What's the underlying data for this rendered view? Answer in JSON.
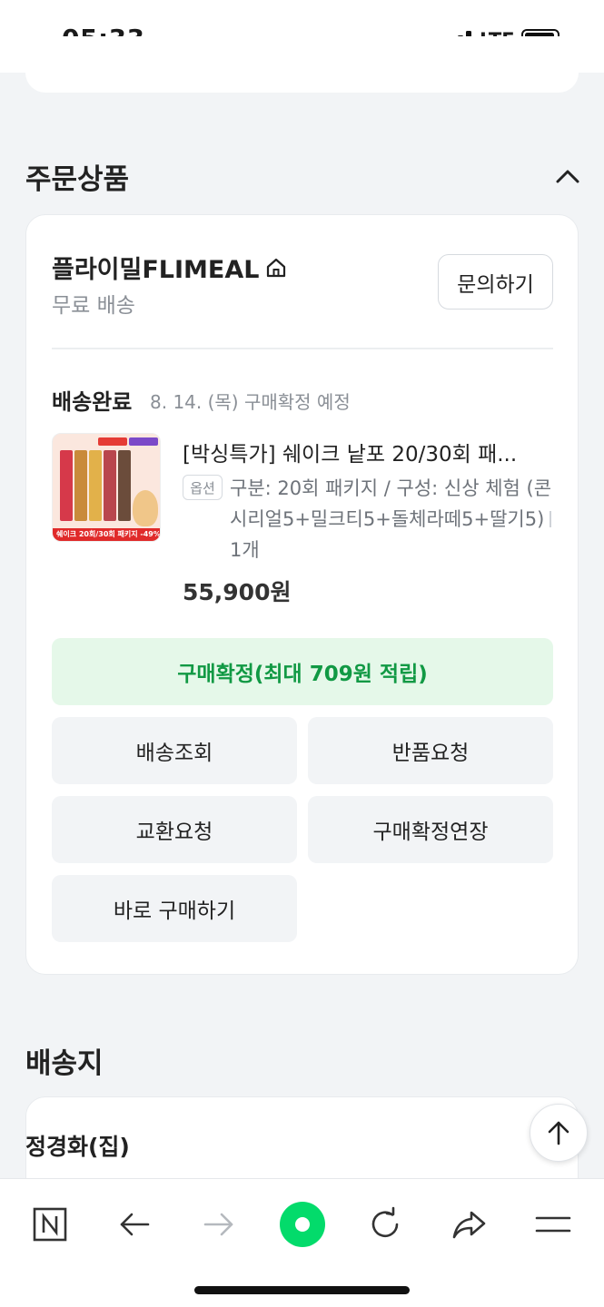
{
  "status_bar": {
    "time": "05:33",
    "network": "LTE"
  },
  "order_items_section": {
    "title": "주문상품"
  },
  "seller": {
    "name": "플라이밀FLIMEAL",
    "shipping_fee": "무료 배송",
    "inquiry_label": "문의하기"
  },
  "delivery": {
    "status": "배송완료",
    "confirm_note": "8. 14. (목) 구매확정 예정"
  },
  "product": {
    "title": "[박싱특가] 쉐이크 낱포 20/30회 패...",
    "option_badge": "옵션",
    "option_text": "구분: 20회 패키지 / 구성: 신상 체험 (콘시리얼5+밀크티5+돌체라떼5+딸기5)",
    "quantity": "1개",
    "price": "55,900원",
    "thumb_caption": "쉐이크 20회/30회 패키지 -49% 할인"
  },
  "actions": {
    "confirm_purchase": "구매확정(최대 709원 적립)",
    "track_delivery": "배송조회",
    "return_request": "반품요청",
    "exchange_request": "교환요청",
    "extend_confirmation": "구매확정연장",
    "buy_again": "바로 구매하기"
  },
  "address_section": {
    "title": "배송지",
    "recipient": "정경화(집)"
  },
  "colors": {
    "accent_green": "#119944",
    "confirm_bg": "#e5f8e9",
    "page_bg": "#f2f4f6",
    "naver_green": "#03db6b"
  },
  "toolbar": {
    "icons": [
      "naver-n-icon",
      "back-arrow-icon",
      "forward-arrow-icon",
      "green-dot-icon",
      "refresh-icon",
      "share-icon",
      "menu-icon"
    ]
  }
}
